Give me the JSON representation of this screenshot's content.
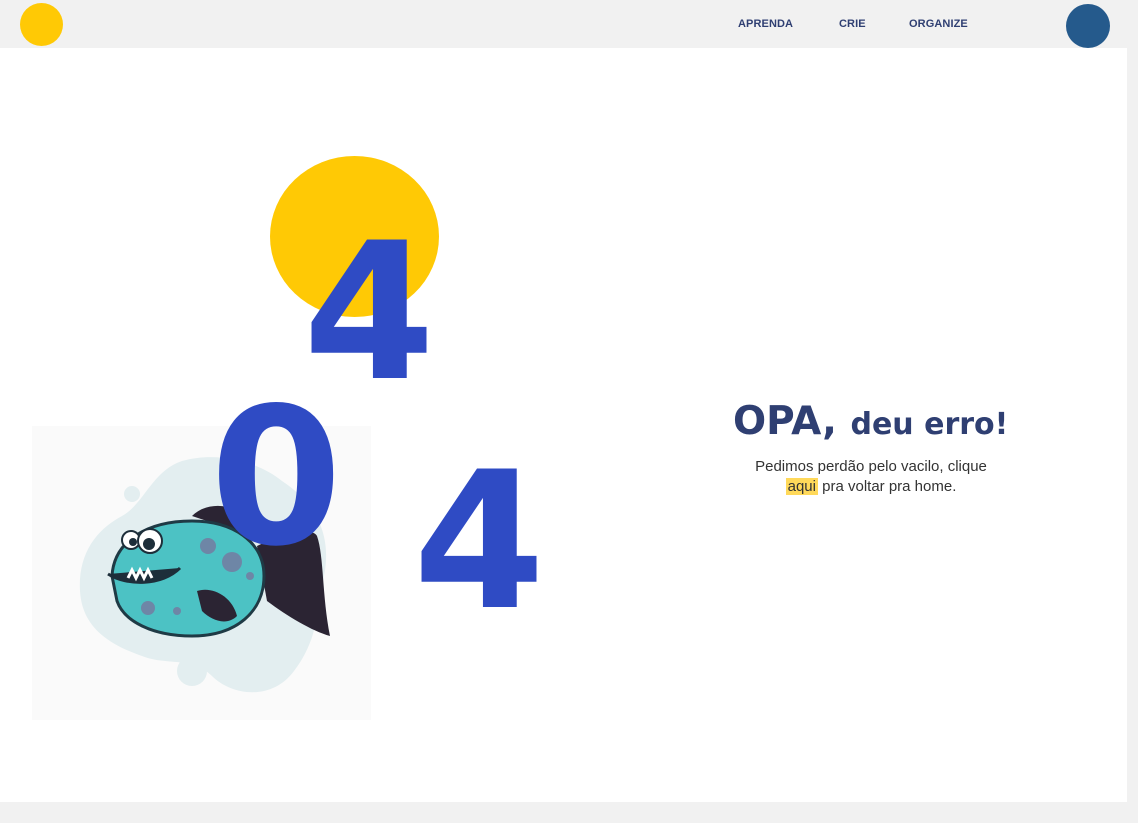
{
  "nav": {
    "items": [
      {
        "label": "APRENDA"
      },
      {
        "label": "CRIE"
      },
      {
        "label": "ORGANIZE"
      }
    ]
  },
  "error": {
    "digits": [
      "4",
      "0",
      "4"
    ],
    "headline_main": "OPA,",
    "headline_rest": "deu erro!",
    "message_before": "Pedimos perdão pelo vacilo, clique",
    "link_text": "aqui",
    "message_after": "pra voltar pra home."
  },
  "icons": {
    "logo": "yellow-circle-logo",
    "avatar": "blue-circle-avatar",
    "illustration": "cartoon-piranha-fish"
  },
  "colors": {
    "accent_yellow": "#ffc905",
    "digit_blue": "#2f4bc4",
    "headline_navy": "#2f3f72",
    "nav_text": "#2f3f72",
    "avatar_blue": "#255a8c",
    "link_highlight": "#ffd95a",
    "fish_teal": "#4cc2c4",
    "fish_fin": "#2b2433",
    "splash": "#e3eef0"
  }
}
